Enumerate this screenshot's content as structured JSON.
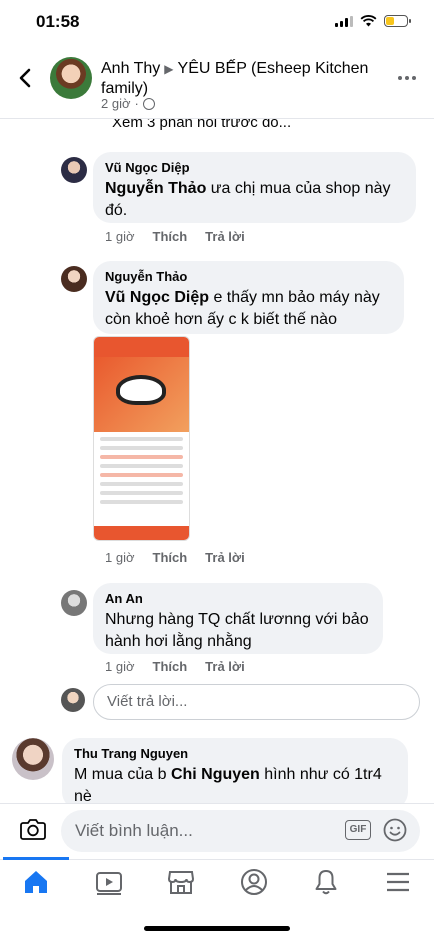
{
  "status_bar": {
    "time": "01:58",
    "battery_level": 0.4
  },
  "header": {
    "author": "Anh Thy",
    "group": "YÊU BẾP (Esheep Kitchen family)",
    "time": "2 giờ"
  },
  "previous_replies": {
    "label": "Xem 3 phản hồi trước đó..."
  },
  "comments": [
    {
      "name": "Vũ Ngọc Diệp",
      "tag": "Nguyễn Thảo",
      "text": " ưa chị mua của shop này đó.",
      "time": "1 giờ",
      "like": "Thích",
      "reply": "Trả lời"
    },
    {
      "name": "Nguyễn Thảo",
      "tag": "Vũ Ngọc Diệp",
      "text": " e thấy mn bảo máy này còn khoẻ hơn ấy c k biết thế nào",
      "time": "1 giờ",
      "like": "Thích",
      "reply": "Trả lời"
    },
    {
      "name": "An An",
      "text": "Nhưng hàng TQ chất lươnng với bảo hành hơi lằng nhằng",
      "time": "1 giờ",
      "like": "Thích",
      "reply": "Trả lời"
    },
    {
      "name": "Thu Trang Nguyen",
      "text_before": "M mua của b ",
      "tag": "Chi Nguyen",
      "text_after": " hình như có 1tr4 nè"
    }
  ],
  "reply_box": {
    "placeholder": "Viết trả lời..."
  },
  "composer": {
    "placeholder": "Viết bình luận...",
    "gif_label": "GIF"
  },
  "tabs": [
    "home-icon",
    "video-icon",
    "marketplace-icon",
    "profile-icon",
    "notifications-icon",
    "menu-icon"
  ],
  "colors": {
    "accent": "#1877f2",
    "bubble": "#f0f2f5",
    "muted": "#65676b"
  }
}
